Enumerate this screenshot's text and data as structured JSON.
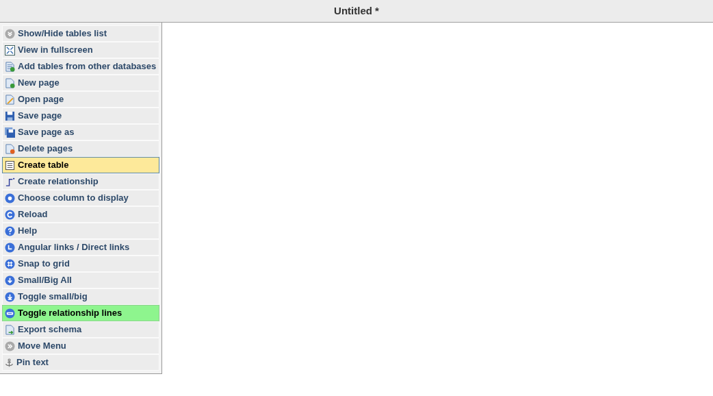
{
  "window": {
    "title": "Untitled *"
  },
  "menu": {
    "items": [
      {
        "label": "Show/Hide tables list",
        "selected": false,
        "on": false
      },
      {
        "label": "View in fullscreen",
        "selected": false,
        "on": false
      },
      {
        "label": "Add tables from other databases",
        "selected": false,
        "on": false
      },
      {
        "label": "New page",
        "selected": false,
        "on": false
      },
      {
        "label": "Open page",
        "selected": false,
        "on": false
      },
      {
        "label": "Save page",
        "selected": false,
        "on": false
      },
      {
        "label": "Save page as",
        "selected": false,
        "on": false
      },
      {
        "label": "Delete pages",
        "selected": false,
        "on": false
      },
      {
        "label": "Create table",
        "selected": true,
        "on": false
      },
      {
        "label": "Create relationship",
        "selected": false,
        "on": false
      },
      {
        "label": "Choose column to display",
        "selected": false,
        "on": false
      },
      {
        "label": "Reload",
        "selected": false,
        "on": false
      },
      {
        "label": "Help",
        "selected": false,
        "on": false
      },
      {
        "label": "Angular links / Direct links",
        "selected": false,
        "on": false
      },
      {
        "label": "Snap to grid",
        "selected": false,
        "on": false
      },
      {
        "label": "Small/Big All",
        "selected": false,
        "on": false
      },
      {
        "label": "Toggle small/big",
        "selected": false,
        "on": false
      },
      {
        "label": "Toggle relationship lines",
        "selected": false,
        "on": true
      },
      {
        "label": "Export schema",
        "selected": false,
        "on": false
      },
      {
        "label": "Move Menu",
        "selected": false,
        "on": false
      },
      {
        "label": "Pin text",
        "selected": false,
        "on": false
      }
    ]
  }
}
